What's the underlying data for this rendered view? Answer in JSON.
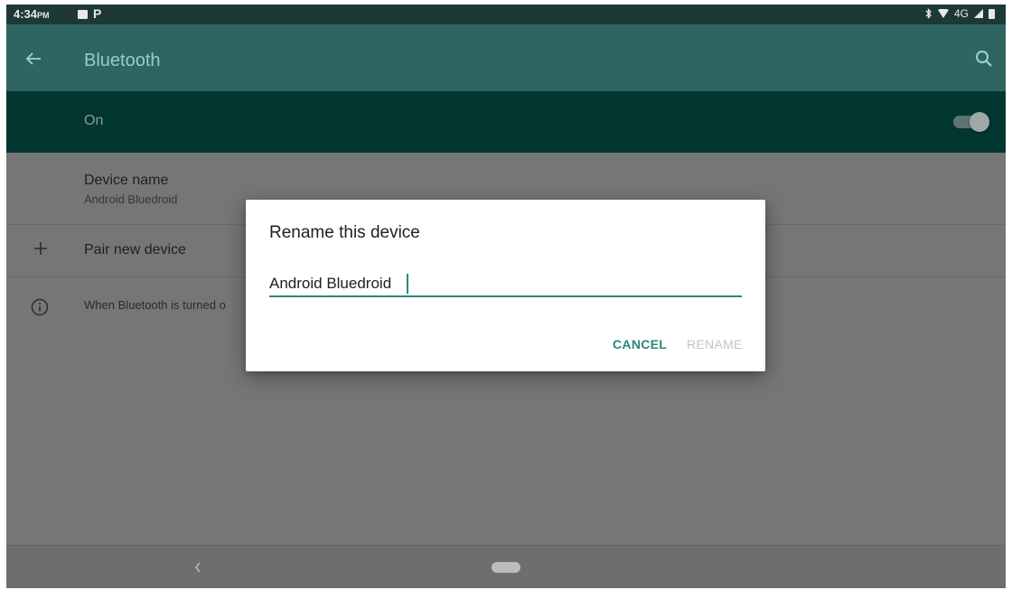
{
  "status_bar": {
    "time": "4:34",
    "ampm": "PM",
    "notification_p": "P",
    "network": "4G"
  },
  "app_bar": {
    "title": "Bluetooth",
    "back_icon": "arrow-left-icon",
    "search_icon": "search-icon"
  },
  "master_switch": {
    "label": "On",
    "state": "on"
  },
  "list": {
    "device_name_title": "Device name",
    "device_name_value": "Android Bluedroid",
    "pair_label": "Pair new device",
    "info_text": "When Bluetooth is turned o"
  },
  "dialog": {
    "title": "Rename this device",
    "input_value": "Android Bluedroid",
    "cancel_label": "CANCEL",
    "rename_label": "RENAME"
  },
  "colors": {
    "accent": "#2a8a7d",
    "app_bar": "#2e6560",
    "switch_bar": "#013631"
  }
}
